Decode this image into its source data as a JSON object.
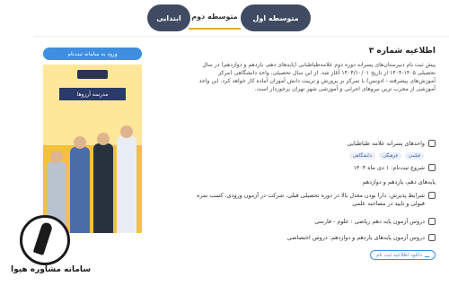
{
  "tabs": [
    {
      "label": "متوسطه اول",
      "active": false
    },
    {
      "label": "متوسطه دوم",
      "active": true
    },
    {
      "label": "ابتدایی",
      "active": false
    }
  ],
  "announcement": {
    "title": "اطلاعیه شماره ۳",
    "register_button": "ورود به سامانه ثبت‌نام",
    "poster_banner": "مدرسه آرزوها",
    "description": "پیش ثبت نام دبیرستان‌های پسرانه دوره دوم علامه‌طباطبایی (پایه‌های دهم، یازدهم و دوازدهم) در سال تحصیلی ۱۴۰۵-۱۴۰۴ از تاریخ ۱۴۰۴/۱۰/۰۱ آغاز شد. از این سال تحصیلی، واحد دانشگاهی (مرکز آموزش‌های پیشرفته - ادونس) با تمرکز بر پرورش و تربیت دانش آموزان آماده کار خواهد کرد. این واحد آموزشی از مجرب ترین نیروهای اجرایی و آموزشی شهر تهران برخوردار است."
  },
  "details": {
    "units_label": "واحدهای پسرانه علامه طباطبایی",
    "tags": [
      "فیلمی",
      "فرهنگی",
      "دانشگاهی"
    ],
    "start_label": "شروع ثبت‌نام: ۱ دی ماه ۱۴۰۴",
    "grades_label": "پایه‌های دهم، یازدهم و دوازدهم",
    "conditions": "شرایط پذیرش: دارا بودن معدل بالا در دوره تحصیلی قبلی، شرکت در آزمون ورودی، کسب نمره قبولی و تایید در مصاحبه علمی",
    "exam_10": "دروس آزمون پایه دهم ریاضی : علوم - فارسی",
    "exam_11_12": "دروس آزمون پایه‌های یازدهم و دوازدهم: دروس اختصاصی",
    "download_button": "دانلود اطلاعیه ثبت نام"
  },
  "watermark": {
    "text": "سامانه مشاوره هیوا"
  }
}
